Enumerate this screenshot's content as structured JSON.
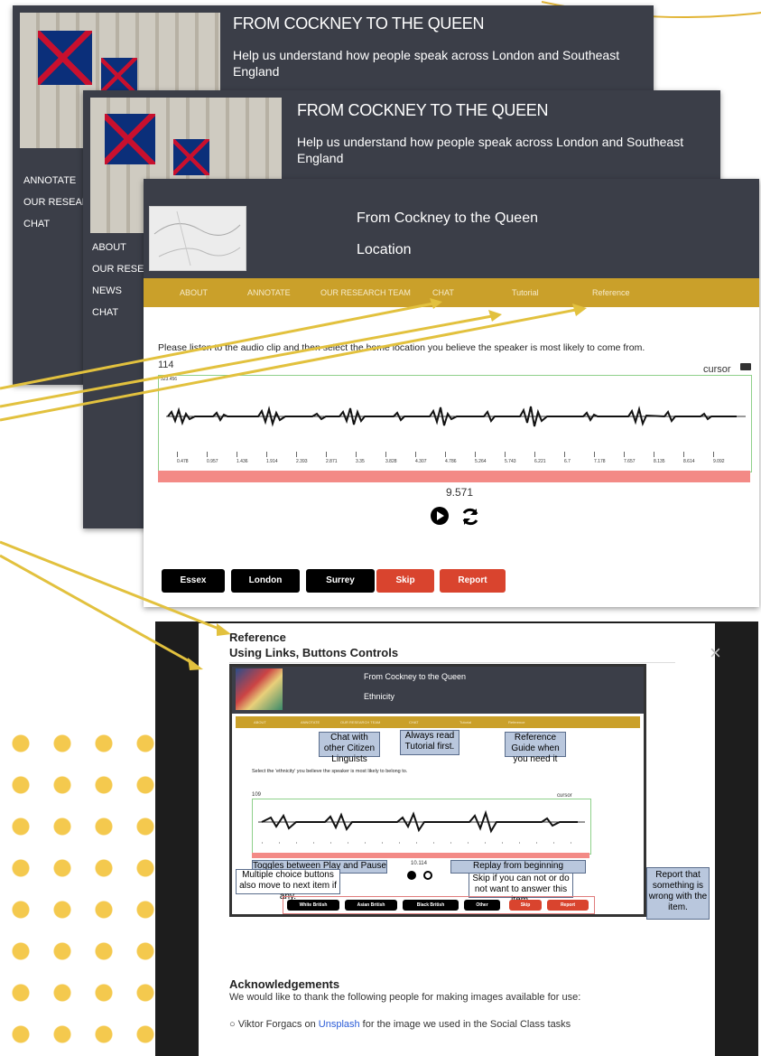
{
  "back_window": {
    "title": "FROM COCKNEY TO THE QUEEN",
    "subtitle": "Help us understand how people speak across London and Southeast England",
    "nav": [
      "ANNOTATE",
      "OUR RESEARCH",
      "CHAT"
    ]
  },
  "middle_window": {
    "title": "FROM COCKNEY TO THE QUEEN",
    "subtitle": "Help us understand how people speak across London and Southeast England",
    "nav": [
      "ABOUT",
      "OUR RESEARC",
      "NEWS",
      "CHAT"
    ]
  },
  "front_window": {
    "title": "From Cockney to the Queen",
    "subtitle": "Location",
    "nav": [
      "ABOUT",
      "ANNOTATE",
      "OUR RESEARCH TEAM",
      "CHAT",
      "Tutorial",
      "Reference"
    ],
    "instruction": "Please listen to the audio clip and then select the home location you believe the speaker is most likely to come from.",
    "clip_id": "114",
    "cursor_label": "cursor",
    "peak_label": "323.456",
    "ticks": [
      "0.478",
      "0.957",
      "1.436",
      "1.914",
      "2.393",
      "2.871",
      "3.35",
      "3.828",
      "4.307",
      "4.786",
      "5.264",
      "5.743",
      "6.221",
      "6.7",
      "7.178",
      "7.657",
      "8.135",
      "8.614",
      "9.092"
    ],
    "duration": "9.571",
    "buttons": [
      "Essex",
      "London",
      "Surrey",
      "Skip",
      "Report"
    ]
  },
  "modal": {
    "heading1": "Reference",
    "heading2": "Using Links, Buttons Controls",
    "close_symbol": "×",
    "inner_title": "From Cockney to the Queen",
    "inner_subtitle": "Ethnicity",
    "inner_nav": [
      "ABOUT",
      "ANNOTATE",
      "OUR RESEARCH TEAM",
      "CHAT",
      "Tutorial",
      "Reference"
    ],
    "inner_instruction": "Select the 'ethnicity' you believe the speaker is most likely to belong to.",
    "inner_clip_id": "109",
    "inner_cursor": "cursor",
    "inner_duration": "10.114",
    "inner_buttons": [
      "White British",
      "Asian British",
      "Black British",
      "Other",
      "Skip",
      "Report"
    ],
    "callouts": {
      "chat": "Chat with other Citizen Linguists",
      "tutorial": "Always read Tutorial first.",
      "reference": "Reference Guide when you need it",
      "play": "Toggles between Play and Pause",
      "replay": "Replay from beginning",
      "multiple": "Multiple choice buttons also move to next item if any.",
      "skip": "Skip if you can not or do not want to answer this item.",
      "report": "Report that something is wrong with the item."
    },
    "ack_heading": "Acknowledgements",
    "ack_text": "We would like to thank the following people for making images available for use:",
    "ack_item_prefix": "Viktor Forgacs on ",
    "ack_item_link": "Unsplash",
    "ack_item_suffix": " for the image we used in the Social Class tasks"
  },
  "colors": {
    "accent": "#caa02a",
    "dark": "#3b3e48",
    "red": "#d9442e",
    "arrow": "#e2c13e"
  }
}
